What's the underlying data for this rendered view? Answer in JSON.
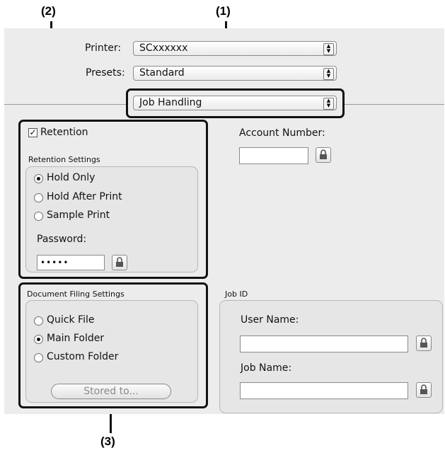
{
  "callouts": {
    "c1": "(1)",
    "c2": "(2)",
    "c3": "(3)"
  },
  "printer": {
    "label": "Printer:",
    "value": "SCxxxxxx"
  },
  "presets": {
    "label": "Presets:",
    "value": "Standard"
  },
  "pane": {
    "value": "Job Handling"
  },
  "retention": {
    "checkbox_label": "Retention",
    "checked": true,
    "settings_label": "Retention Settings",
    "options": [
      "Hold Only",
      "Hold After Print",
      "Sample Print"
    ],
    "selected_index": 0,
    "password_label": "Password:",
    "password_value": "•••••"
  },
  "account": {
    "label": "Account Number:",
    "value": ""
  },
  "filing": {
    "label": "Document Filing Settings",
    "options": [
      "Quick File",
      "Main Folder",
      "Custom Folder"
    ],
    "selected_index": 1,
    "stored_button": "Stored to..."
  },
  "jobid": {
    "label": "Job ID",
    "user_name_label": "User Name:",
    "user_name_value": "",
    "job_name_label": "Job Name:",
    "job_name_value": ""
  },
  "icons": {
    "lock": "lock-icon",
    "popup": "updown-arrows-icon",
    "check": "checkmark-icon"
  }
}
